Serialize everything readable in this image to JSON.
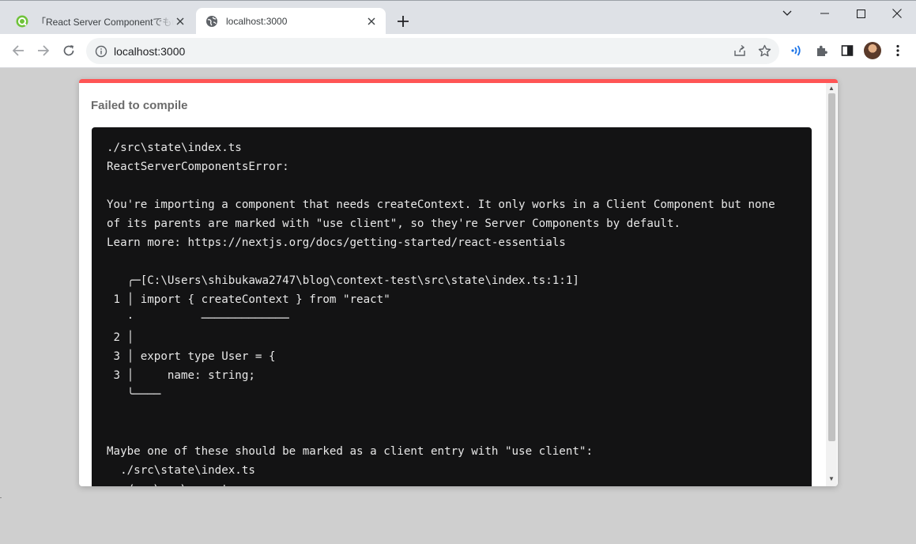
{
  "tabs": [
    {
      "title": "「React Server Componentでもuse",
      "favicon": "zenn-icon",
      "favicon_color": "#3ea8ff"
    },
    {
      "title": "localhost:3000",
      "favicon": "globe-icon"
    }
  ],
  "window_controls": [
    "chevron-down-icon",
    "minimize-icon",
    "maximize-icon",
    "close-icon"
  ],
  "toolbar": {
    "url": "localhost:3000"
  },
  "overlay": {
    "title": "Failed to compile",
    "accent_color": "#ff5555",
    "code_lines": [
      "./src\\state\\index.ts",
      "ReactServerComponentsError:",
      "",
      "You're importing a component that needs createContext. It only works in a Client Component but none",
      "of its parents are marked with \"use client\", so they're Server Components by default.",
      "Learn more: https://nextjs.org/docs/getting-started/react-essentials",
      "",
      "   ╭─[C:\\Users\\shibukawa2747\\blog\\context-test\\src\\state\\index.ts:1:1]",
      " 1 │ import { createContext } from \"react\"",
      "   ·          ─────────────",
      " 2 │",
      " 3 │ export type User = {",
      " 3 │     name: string;",
      "   ╰────",
      "",
      "",
      "Maybe one of these should be marked as a client entry with \"use client\":",
      "  ./src\\state\\index.ts",
      "  ./src\\app\\page.tsx"
    ]
  }
}
